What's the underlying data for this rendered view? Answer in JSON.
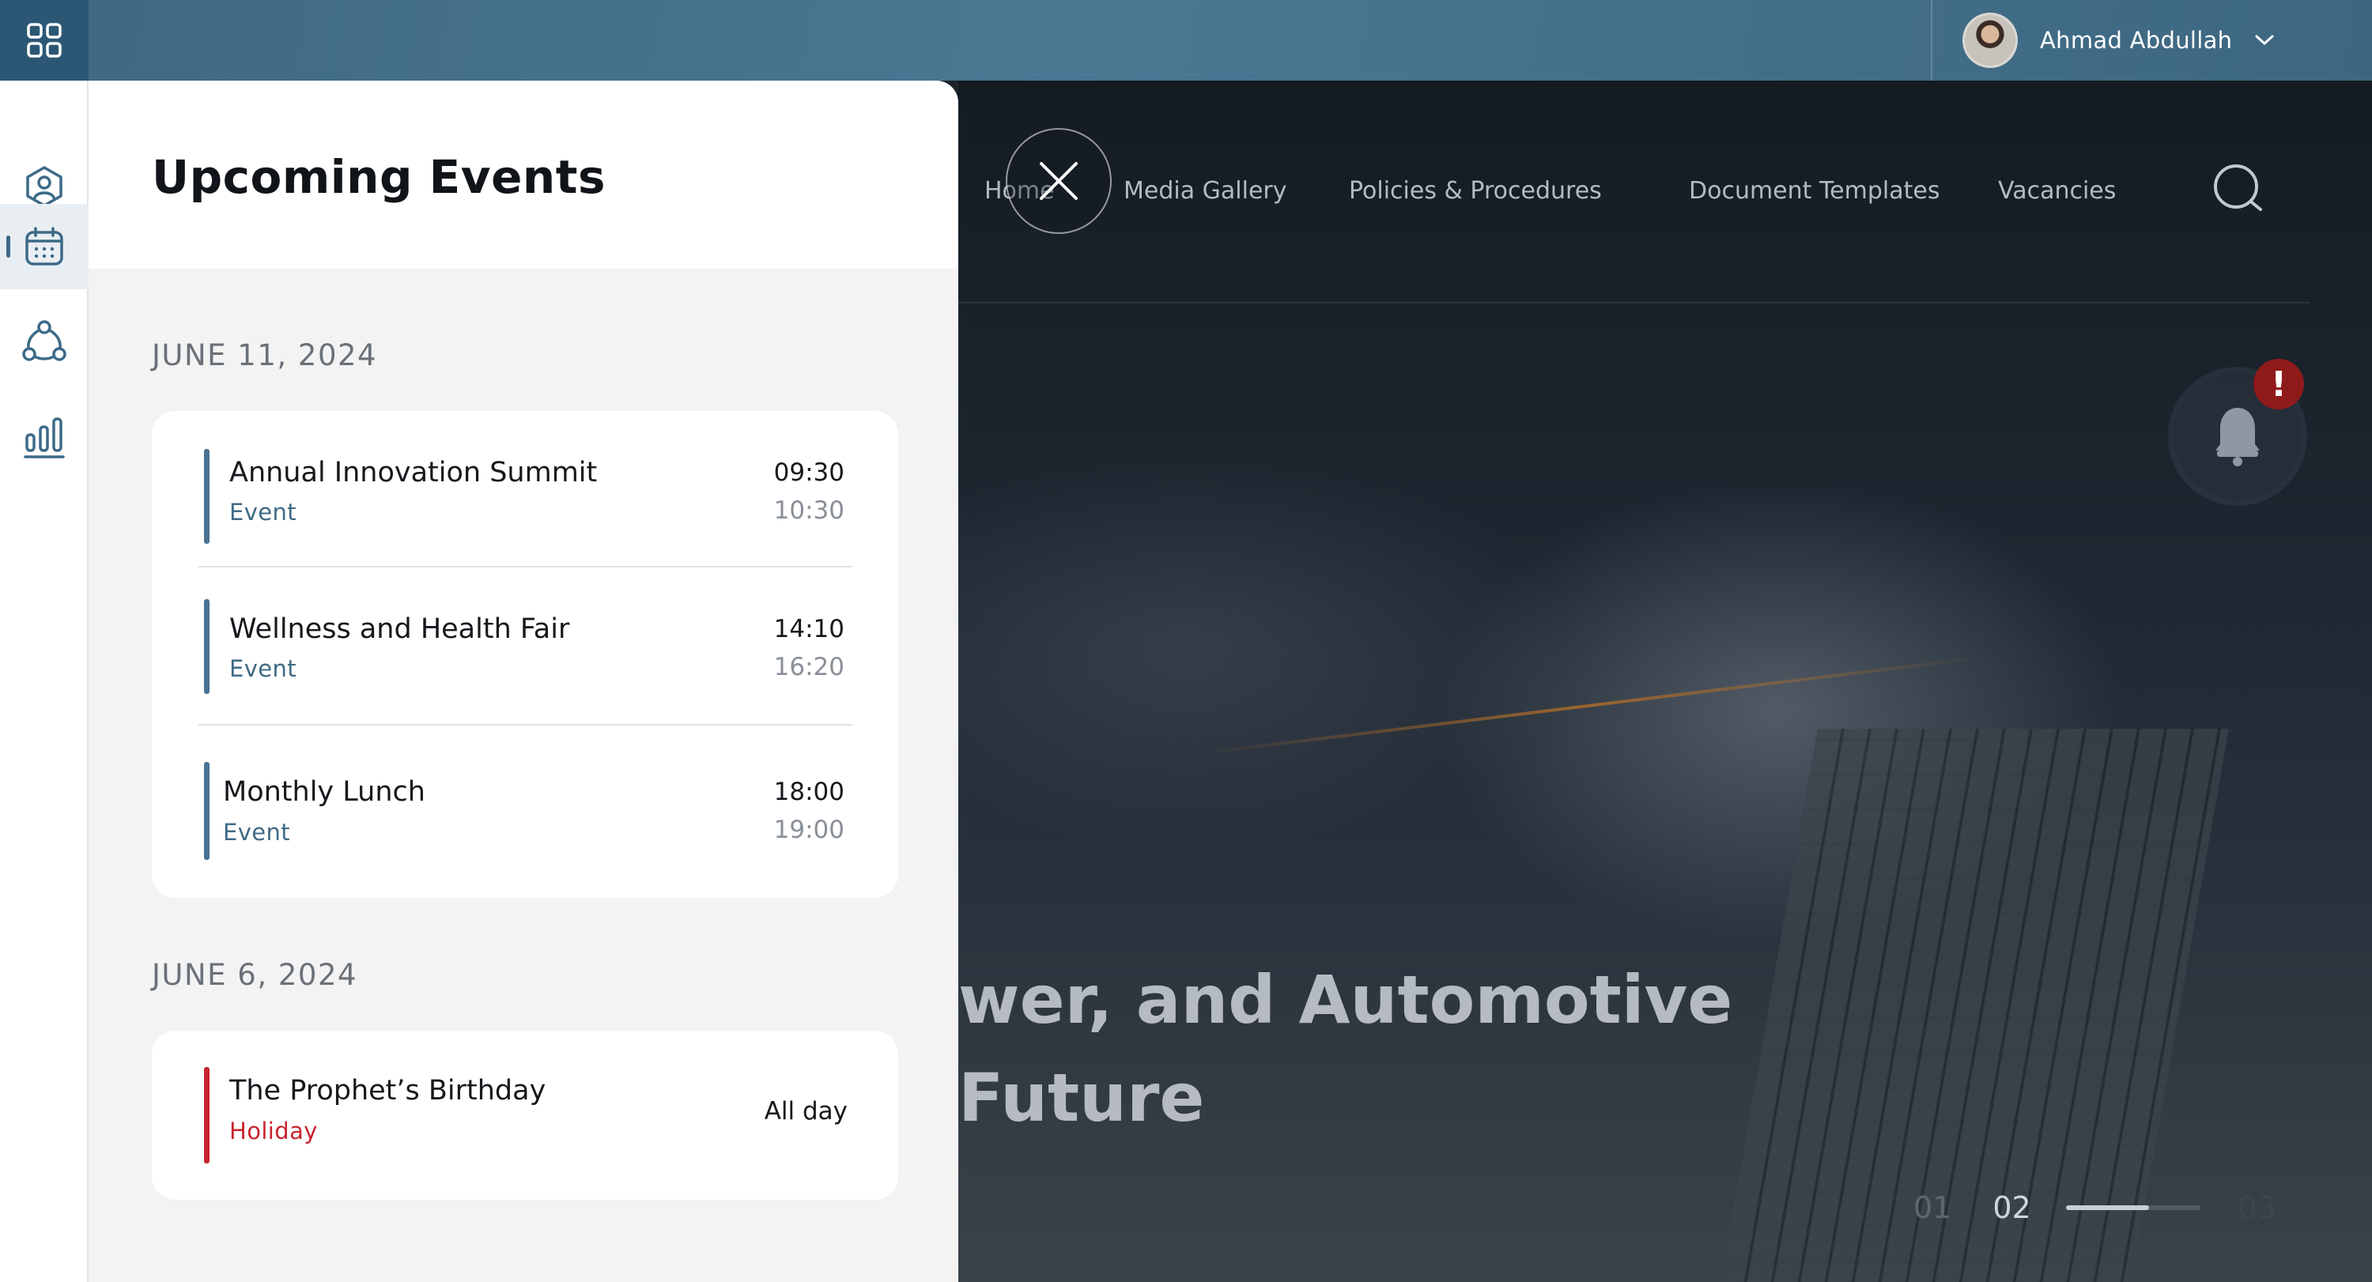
{
  "app": {
    "user": {
      "name": "Ahmad Abdullah"
    }
  },
  "nav": {
    "items": [
      "Home",
      "Media Gallery",
      "Policies & Procedures",
      "Document Templates",
      "Vacancies"
    ]
  },
  "hero": {
    "title_line1": "wer, and Automotive",
    "title_line2": "Future",
    "pager": {
      "first": "01",
      "current": "02",
      "next": "03",
      "progress": 0.62
    }
  },
  "notifications": {
    "badge": "!"
  },
  "events_panel": {
    "title": "Upcoming Events",
    "groups": [
      {
        "date": "JUNE 11, 2024",
        "events": [
          {
            "name": "Annual Innovation Summit",
            "type": "Event",
            "start": "09:30",
            "end": "10:30"
          },
          {
            "name": "Wellness and Health Fair",
            "type": "Event",
            "start": "14:10",
            "end": "16:20"
          },
          {
            "name": "Monthly Lunch",
            "type": "Event",
            "start": "18:00",
            "end": "19:00"
          }
        ]
      },
      {
        "date": "JUNE 6, 2024",
        "events": [
          {
            "name": "The Prophet’s Birthday",
            "type": "Holiday",
            "time": "All day"
          }
        ]
      }
    ]
  },
  "icons": {
    "apps": "grid-icon",
    "rail": [
      "user-circle-icon",
      "calendar-icon",
      "network-icon",
      "bar-chart-icon"
    ],
    "close": "close-icon",
    "search": "search-icon",
    "bell": "bell-icon",
    "user_menu": "chevron-down-icon"
  },
  "colors": {
    "accent": "#3d6a88",
    "event_bar": "#4a7394",
    "holiday_bar": "#c8242f",
    "event_type": "#3f6a85",
    "holiday_type": "#c8242f"
  }
}
